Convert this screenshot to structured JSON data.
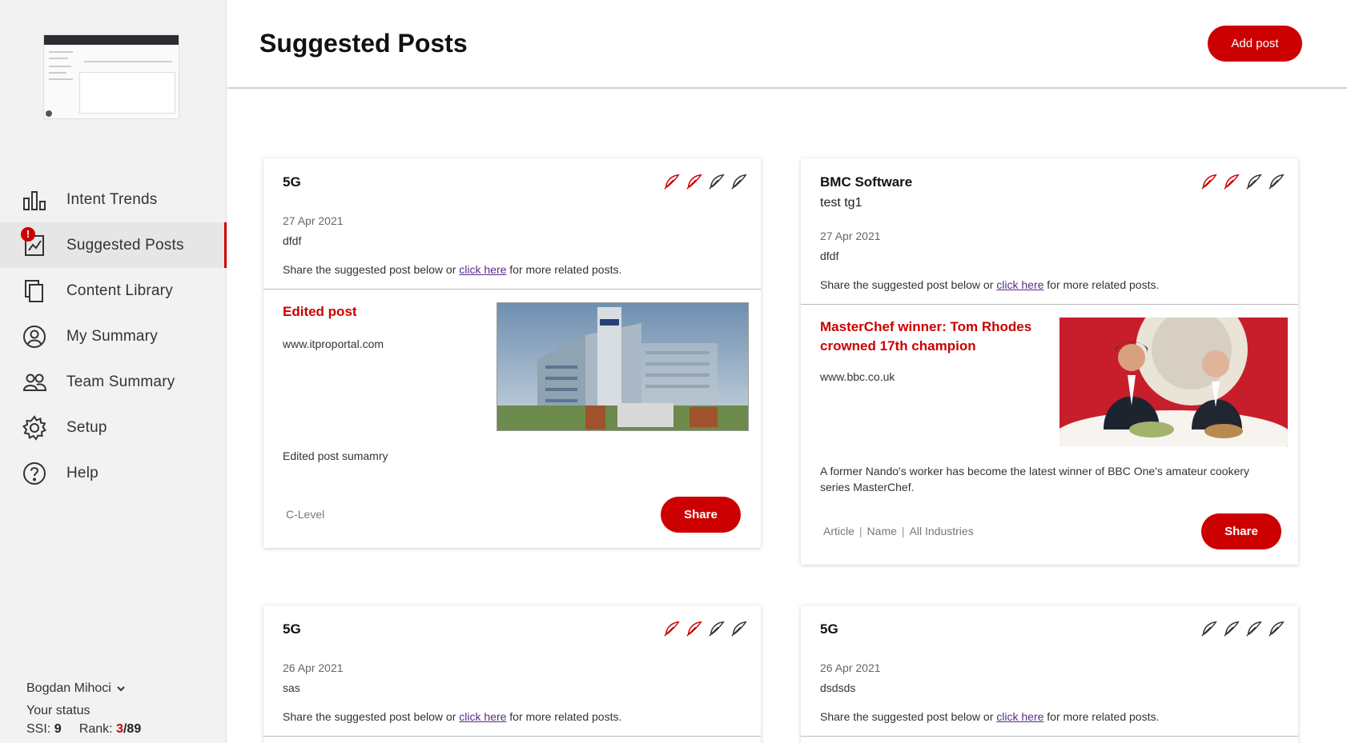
{
  "sidebar": {
    "items": [
      {
        "label": "Intent Trends"
      },
      {
        "label": "Suggested Posts",
        "badge": "!"
      },
      {
        "label": "Content Library"
      },
      {
        "label": "My Summary"
      },
      {
        "label": "Team Summary"
      },
      {
        "label": "Setup"
      },
      {
        "label": "Help"
      }
    ],
    "user_name": "Bogdan Mihoci",
    "status_label": "Your status",
    "ssi_label": "SSI:",
    "ssi_value": "9",
    "rank_label": "Rank:",
    "rank_value": "3",
    "rank_total": "/89"
  },
  "header": {
    "title": "Suggested Posts",
    "add_label": "Add post"
  },
  "share_text": {
    "before": "Share the suggested post below or ",
    "link": "click here",
    "after": " for more related posts."
  },
  "cards": [
    {
      "topic": "5G",
      "date": "27 Apr 2021",
      "note": "dfdf",
      "article_title": "Edited post",
      "article_source": "www.itproportal.com",
      "article_summary": "Edited post sumamry",
      "tags": [
        "C-Level"
      ],
      "share_label": "Share",
      "feathers_active": 2
    },
    {
      "topic": "BMC Software",
      "subtopic": "test tg1",
      "date": "27 Apr 2021",
      "note": "dfdf",
      "article_title": "MasterChef winner: Tom Rhodes crowned 17th champion",
      "article_source": "www.bbc.co.uk",
      "article_summary": "A former Nando's worker has become the latest winner of BBC One's amateur cookery series MasterChef.",
      "tags": [
        "Article",
        "Name",
        "All Industries"
      ],
      "share_label": "Share",
      "feathers_active": 2
    },
    {
      "topic": "5G",
      "date": "26 Apr 2021",
      "note": "sas",
      "feathers_active": 2
    },
    {
      "topic": "5G",
      "date": "26 Apr 2021",
      "note": "dsdsds",
      "feathers_active": 0
    }
  ],
  "colors": {
    "accent": "#cc0000",
    "link": "#5b2a86",
    "feather_inactive": "#333333"
  }
}
